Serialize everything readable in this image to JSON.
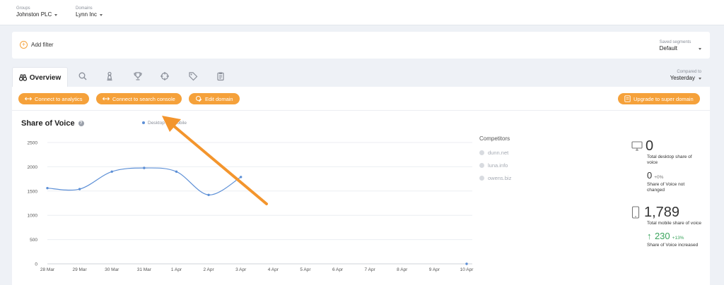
{
  "topbar": {
    "groups": {
      "label": "Groups",
      "value": "Johnston PLC"
    },
    "domains": {
      "label": "Domains",
      "value": "Lynn Inc"
    }
  },
  "filter": {
    "add_label": "Add filter",
    "segments_label": "Saved segments",
    "segments_value": "Default"
  },
  "tabs": {
    "overview_label": "Overview",
    "icons": [
      "search-icon",
      "chess-pawn-icon",
      "trophy-icon",
      "crosshair-icon",
      "tags-icon",
      "clipboard-icon"
    ]
  },
  "compared": {
    "label": "Compared to",
    "value": "Yesterday"
  },
  "buttons": {
    "analytics": "Connect to analytics",
    "search_console": "Connect to search console",
    "edit_domain": "Edit domain",
    "upgrade": "Upgrade to super domain"
  },
  "colors": {
    "accent": "#f5a13a",
    "line": "#5c8fd6",
    "positive": "#3aa45c"
  },
  "sov": {
    "title": "Share of Voice",
    "legend": [
      "Desktop",
      "Mobile"
    ]
  },
  "competitors": {
    "header": "Competitors",
    "items": [
      "dunn.net",
      "luna.info",
      "owens.biz"
    ]
  },
  "stats": {
    "desktop_value": "0",
    "desktop_label": "Total desktop share of voice",
    "desktop_change": "0",
    "desktop_change_pct": "+0%",
    "desktop_change_label": "Share of Voice not changed",
    "mobile_value": "1,789",
    "mobile_label": "Total mobile share of voice",
    "mobile_change": "230",
    "mobile_change_pct": "+13%",
    "mobile_change_label": "Share of Voice increased"
  },
  "chart_data": {
    "type": "line",
    "categories": [
      "28 Mar",
      "29 Mar",
      "30 Mar",
      "31 Mar",
      "1 Apr",
      "2 Apr",
      "3 Apr",
      "4 Apr",
      "5 Apr",
      "6 Apr",
      "7 Apr",
      "8 Apr",
      "9 Apr",
      "10 Apr"
    ],
    "series": [
      {
        "name": "Mobile",
        "values": [
          1560,
          1540,
          1900,
          1975,
          1900,
          1420,
          1789,
          null,
          null,
          null,
          null,
          null,
          null,
          0
        ]
      }
    ],
    "yticks": [
      0,
      500,
      1000,
      1500,
      2000,
      2500
    ],
    "ylim": [
      0,
      2500
    ],
    "grid": true
  }
}
